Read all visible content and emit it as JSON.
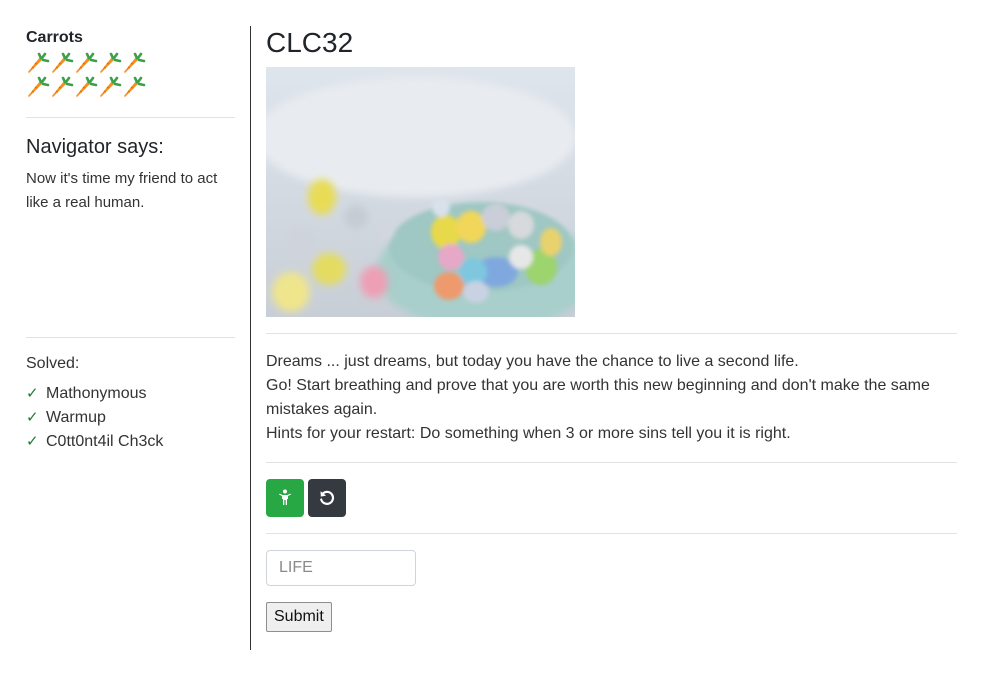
{
  "sidebar": {
    "carrots_title": "Carrots",
    "carrot_count": 10,
    "navigator_title": "Navigator says:",
    "navigator_text": "Now it's time my friend to act like a real human.",
    "solved_label": "Solved:",
    "solved_items": [
      "Mathonymous",
      "Warmup",
      "C0tt0nt4il Ch3ck"
    ],
    "check_glyph": "✓"
  },
  "main": {
    "title": "CLC32",
    "description": [
      "Dreams ... just dreams, but today you have the chance to live a second life.",
      "Go! Start breathing and prove that you are worth this new beginning and don't make the same mistakes again.",
      "Hints for your restart: Do something when 3 or more sins tell you it is right."
    ],
    "buttons": {
      "hint_icon": "person-standing-icon",
      "reset_icon": "restart-icon"
    },
    "answer_placeholder": "LIFE",
    "answer_value": "",
    "submit_label": "Submit"
  },
  "colors": {
    "success": "#28a745",
    "dark": "#343a40",
    "carrot_orange": "#f4901e",
    "carrot_leaf": "#3aa14a"
  }
}
